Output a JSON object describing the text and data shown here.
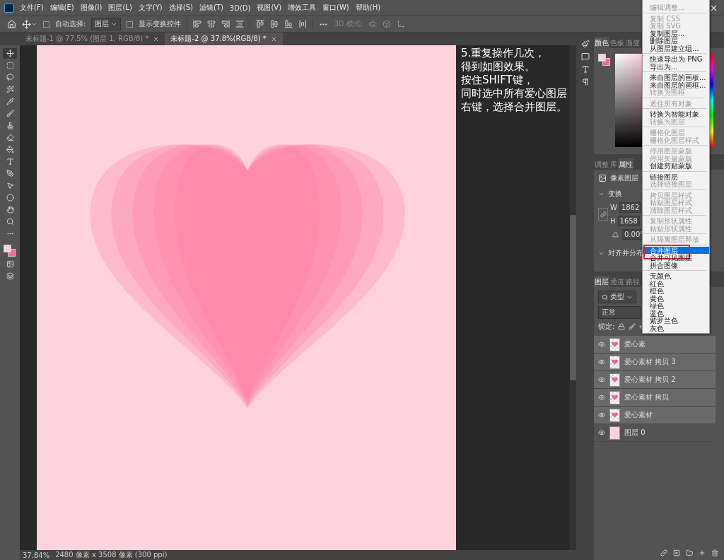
{
  "menu_bar": {
    "items": [
      "文件(F)",
      "编辑(E)",
      "图像(I)",
      "图层(L)",
      "文字(Y)",
      "选择(S)",
      "滤镜(T)",
      "3D(D)",
      "视图(V)",
      "增效工具",
      "窗口(W)",
      "帮助(H)"
    ]
  },
  "options_bar": {
    "auto_select": {
      "label": "自动选择:",
      "checked": false
    },
    "target": "图层",
    "show_transform": {
      "label": "显示变换控件",
      "checked": false
    },
    "mode_3d": "3D 模式:"
  },
  "doc_tabs": [
    {
      "title": "未标题-1 @ 77.5% (图层 1, RGB/8) *",
      "selected": false
    },
    {
      "title": "未标题-2 @ 37.8%(RGB/8) *",
      "selected": true
    }
  ],
  "tools": [
    {
      "kind": "move",
      "selected": true
    },
    {
      "kind": "marquee",
      "selected": false
    },
    {
      "kind": "lasso",
      "selected": false
    },
    {
      "kind": "select",
      "selected": false
    },
    {
      "kind": "eyedropper",
      "selected": false
    },
    {
      "kind": "brush",
      "selected": false
    },
    {
      "kind": "stamp",
      "selected": false
    },
    {
      "kind": "eraser",
      "selected": false
    },
    {
      "kind": "bucket",
      "selected": false
    },
    {
      "kind": "text",
      "selected": false
    },
    {
      "kind": "pen",
      "selected": false
    },
    {
      "kind": "pointer",
      "selected": false
    },
    {
      "kind": "shape",
      "selected": false
    },
    {
      "kind": "hand",
      "selected": false
    },
    {
      "kind": "zoom",
      "selected": false
    },
    {
      "kind": "more",
      "selected": false
    }
  ],
  "annotation": [
    "5.重复操作几次，",
    "得到如图效果。",
    "按住SHIFT键，",
    "同时选中所有爱心图层",
    "右键，选择合并图层。"
  ],
  "color_panel": {
    "tabs": [
      {
        "label": "颜色",
        "selected": true
      },
      {
        "label": "色板",
        "selected": false
      },
      {
        "label": "渐变",
        "selected": false
      }
    ]
  },
  "properties_panel": {
    "tabs": [
      {
        "label": "调整",
        "selected": false
      },
      {
        "label": "库",
        "selected": false
      },
      {
        "label": "属性",
        "selected": true
      }
    ],
    "layer_kind": "像素图层",
    "transform_title": "变换",
    "w_label": "W",
    "w_value": "1862",
    "h_label": "H",
    "h_value": "1658",
    "angle": "0.00°",
    "align_title": "对齐并分布"
  },
  "layers_panel": {
    "tabs": [
      {
        "label": "图层",
        "selected": true
      },
      {
        "label": "通道",
        "selected": false
      },
      {
        "label": "路径",
        "selected": false
      }
    ],
    "filter": "类型",
    "blend_mode": "正常",
    "lock_label": "锁定:",
    "rows": [
      {
        "name": "爱心素",
        "selected": true,
        "visible": true,
        "kind": "heart"
      },
      {
        "name": "爱心素材 拷贝 3",
        "selected": true,
        "visible": true,
        "kind": "heart"
      },
      {
        "name": "爱心素材 拷贝 2",
        "selected": true,
        "visible": true,
        "kind": "heart"
      },
      {
        "name": "爱心素材 拷贝",
        "selected": true,
        "visible": true,
        "kind": "heart"
      },
      {
        "name": "爱心素材",
        "selected": true,
        "visible": true,
        "kind": "heart"
      },
      {
        "name": "图层 0",
        "selected": false,
        "visible": true,
        "kind": "fill"
      }
    ]
  },
  "context_menu": {
    "groups": [
      [
        {
          "label": "编辑调整...",
          "disabled": true,
          "selected": false
        }
      ],
      [
        {
          "label": "复制 CSS",
          "disabled": true,
          "selected": false
        },
        {
          "label": "复制 SVG",
          "disabled": true,
          "selected": false
        },
        {
          "label": "复制图层...",
          "disabled": false,
          "selected": false
        },
        {
          "label": "删除图层",
          "disabled": false,
          "selected": false
        },
        {
          "label": "从图层建立组...",
          "disabled": false,
          "selected": false
        }
      ],
      [
        {
          "label": "快速导出为 PNG",
          "disabled": false,
          "selected": false
        },
        {
          "label": "导出为...",
          "disabled": false,
          "selected": false
        }
      ],
      [
        {
          "label": "来自图层的画板...",
          "disabled": false,
          "selected": false
        },
        {
          "label": "来自图层的画框...",
          "disabled": false,
          "selected": false
        },
        {
          "label": "转换为图框",
          "disabled": true,
          "selected": false
        }
      ],
      [
        {
          "label": "遮住所有对象",
          "disabled": true,
          "selected": false
        }
      ],
      [
        {
          "label": "转换为智能对象",
          "disabled": false,
          "selected": false
        },
        {
          "label": "转换为图层",
          "disabled": true,
          "selected": false
        }
      ],
      [
        {
          "label": "栅格化图层",
          "disabled": true,
          "selected": false
        },
        {
          "label": "栅格化图层样式",
          "disabled": true,
          "selected": false
        }
      ],
      [
        {
          "label": "停用图层蒙版",
          "disabled": true,
          "selected": false
        },
        {
          "label": "停用矢量蒙版",
          "disabled": true,
          "selected": false
        },
        {
          "label": "创建剪贴蒙版",
          "disabled": false,
          "selected": false
        }
      ],
      [
        {
          "label": "链接图层",
          "disabled": false,
          "selected": false
        },
        {
          "label": "选择链接图层",
          "disabled": true,
          "selected": false
        }
      ],
      [
        {
          "label": "拷贝图层样式",
          "disabled": true,
          "selected": false
        },
        {
          "label": "粘贴图层样式",
          "disabled": true,
          "selected": false
        },
        {
          "label": "清除图层样式",
          "disabled": true,
          "selected": false
        }
      ],
      [
        {
          "label": "复制形状属性",
          "disabled": true,
          "selected": false
        },
        {
          "label": "粘贴形状属性",
          "disabled": true,
          "selected": false
        }
      ],
      [
        {
          "label": "从隔离图层释放",
          "disabled": true,
          "selected": false
        }
      ],
      [
        {
          "label": "合并图层",
          "disabled": false,
          "selected": true,
          "callout": true
        },
        {
          "label": "合并可见图层",
          "disabled": false,
          "selected": false
        },
        {
          "label": "拼合图像",
          "disabled": false,
          "selected": false
        }
      ],
      [
        {
          "label": "无颜色",
          "disabled": false,
          "selected": false
        },
        {
          "label": "红色",
          "disabled": false,
          "selected": false
        },
        {
          "label": "橙色",
          "disabled": false,
          "selected": false
        },
        {
          "label": "黄色",
          "disabled": false,
          "selected": false
        },
        {
          "label": "绿色",
          "disabled": false,
          "selected": false
        },
        {
          "label": "蓝色",
          "disabled": false,
          "selected": false
        },
        {
          "label": "紫罗兰色",
          "disabled": false,
          "selected": false
        },
        {
          "label": "灰色",
          "disabled": false,
          "selected": false
        }
      ]
    ]
  },
  "status_bar": {
    "zoom": "37.84%",
    "doc_info": "2480 像素 x 3508 像素 (300 ppi)"
  }
}
